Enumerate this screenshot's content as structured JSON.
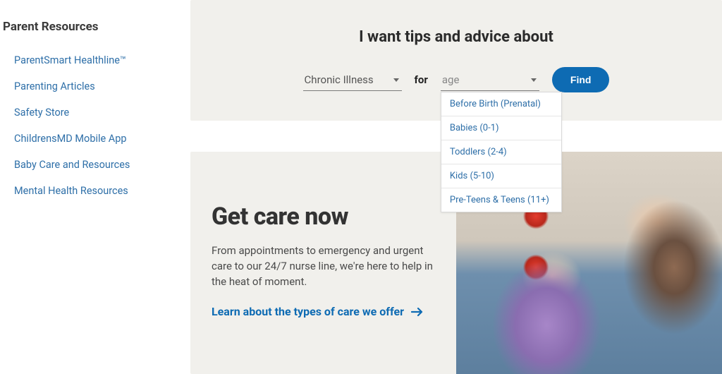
{
  "sidebar": {
    "heading": "Parent Resources",
    "items": [
      {
        "label": "ParentSmart Healthline™"
      },
      {
        "label": "Parenting Articles"
      },
      {
        "label": "Safety Store"
      },
      {
        "label": "ChildrensMD Mobile App"
      },
      {
        "label": "Baby Care and Resources"
      },
      {
        "label": "Mental Health Resources"
      }
    ]
  },
  "tips": {
    "heading": "I want tips and advice about",
    "topic_value": "Chronic Illness",
    "for_label": "for",
    "age_placeholder": "age",
    "find_label": "Find",
    "age_options": [
      "Before Birth (Prenatal)",
      "Babies (0-1)",
      "Toddlers (2-4)",
      "Kids (5-10)",
      "Pre-Teens & Teens (11+)"
    ]
  },
  "care": {
    "title": "Get care now",
    "body": "From appointments to emergency and urgent care to our 24/7 nurse line, we're here to help in the heat of moment.",
    "link_text": "Learn about the types of care we offer"
  }
}
